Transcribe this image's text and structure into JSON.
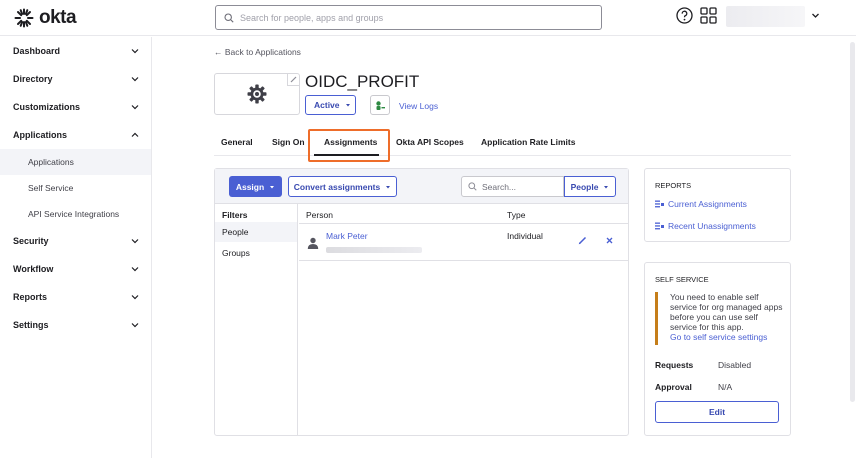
{
  "brand": {
    "logo_text": "okta"
  },
  "search": {
    "placeholder": "Search for people, apps and groups"
  },
  "sidebar": {
    "items": [
      {
        "label": "Dashboard"
      },
      {
        "label": "Directory"
      },
      {
        "label": "Customizations"
      },
      {
        "label": "Applications"
      },
      {
        "label": "Security"
      },
      {
        "label": "Workflow"
      },
      {
        "label": "Reports"
      },
      {
        "label": "Settings"
      }
    ],
    "sub_items": [
      {
        "label": "Applications"
      },
      {
        "label": "Self Service"
      },
      {
        "label": "API Service Integrations"
      }
    ]
  },
  "app": {
    "back_label": "← Back to Applications",
    "title": "OIDC_PROFIT",
    "status": "Active",
    "view_logs": "View Logs"
  },
  "tabs": [
    {
      "label": "General"
    },
    {
      "label": "Sign On"
    },
    {
      "label": "Assignments"
    },
    {
      "label": "Okta API Scopes"
    },
    {
      "label": "Application Rate Limits"
    }
  ],
  "assignments": {
    "assign_label": "Assign",
    "convert_label": "Convert assignments",
    "search_placeholder": "Search...",
    "people_filter": "People",
    "filters_header": "Filters",
    "filters": [
      {
        "label": "People"
      },
      {
        "label": "Groups"
      }
    ],
    "columns": {
      "person": "Person",
      "type": "Type"
    },
    "rows": [
      {
        "name": "Mark Peter",
        "type": "Individual"
      }
    ]
  },
  "reports": {
    "title": "REPORTS",
    "links": [
      {
        "label": "Current Assignments"
      },
      {
        "label": "Recent Unassignments"
      }
    ]
  },
  "self_service": {
    "title": "SELF SERVICE",
    "notice": "You need to enable self service for org managed apps before you can use self service for this app.",
    "notice_link": "Go to self service settings",
    "requests_label": "Requests",
    "requests_value": "Disabled",
    "approval_label": "Approval",
    "approval_value": "N/A",
    "edit_label": "Edit"
  },
  "colors": {
    "accent": "#4a5fd3",
    "highlight": "#ee6d2a",
    "warning": "#c57e1a"
  }
}
